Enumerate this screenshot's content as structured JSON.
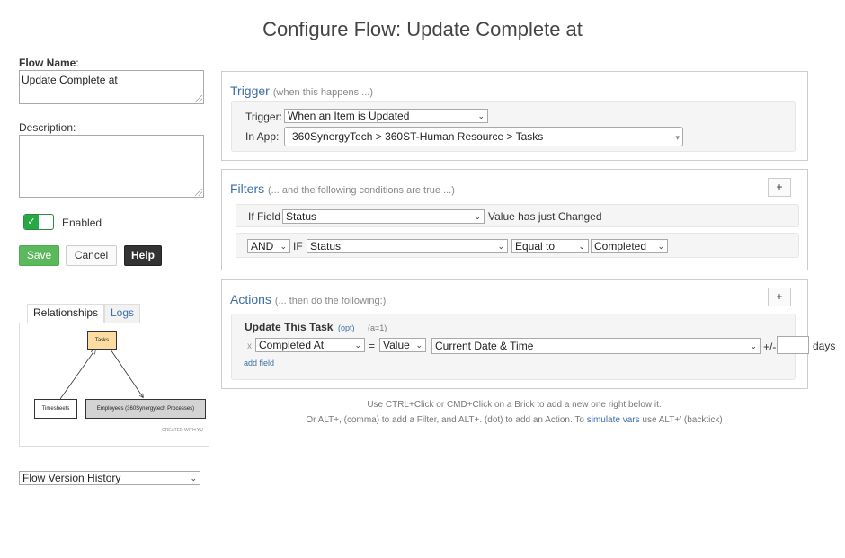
{
  "page": {
    "title": "Configure Flow: Update Complete at"
  },
  "left": {
    "flow_name_label": "Flow Name",
    "flow_name_value": "Update Complete at",
    "description_label": "Description:",
    "description_value": "",
    "enabled_label": "Enabled",
    "enabled": true,
    "buttons": {
      "save": "Save",
      "cancel": "Cancel",
      "help": "Help"
    },
    "tabs": [
      {
        "label": "Relationships",
        "active": true
      },
      {
        "label": "Logs",
        "active": false
      }
    ],
    "diagram": {
      "nodes": {
        "tasks": "Tasks",
        "timesheets": "Timesheets",
        "employees": "Employees (360Synergytech Processes)"
      },
      "watermark": "CREATED WITH YU"
    },
    "version_history": "Flow Version History"
  },
  "trigger": {
    "title": "Trigger",
    "subtitle": "(when this happens ...)",
    "trigger_label": "Trigger:",
    "trigger_value": "When an Item is Updated",
    "app_label": "In App:",
    "app_value": "360SynergyTech > 360ST-Human Resource > Tasks"
  },
  "filters": {
    "title": "Filters",
    "subtitle": "(... and the following conditions are true ...)",
    "add": "+",
    "row1": {
      "prefix": "If Field",
      "field": "Status",
      "suffix": "Value has just Changed"
    },
    "row2": {
      "conj": "AND",
      "if": "IF",
      "field": "Status",
      "op": "Equal to",
      "value": "Completed"
    }
  },
  "actions": {
    "title": "Actions",
    "subtitle": "(... then do the following:)",
    "add": "+",
    "task_title": "Update This Task",
    "opt": "(opt)",
    "count": "(a=1)",
    "remove": "x",
    "field": "Completed At",
    "equals": "=",
    "mode": "Value",
    "value": "Current Date & Time",
    "plusminus": "+/-",
    "days": "days",
    "add_field": "add field"
  },
  "hints": {
    "line1": "Use CTRL+Click or CMD+Click on a Brick to add a new one right below it.",
    "line2_pre": "Or ALT+, (comma) to add a Filter, and ALT+. (dot) to add an Action. To ",
    "line2_link": "simulate vars",
    "line2_post": " use ALT+' (backtick)"
  }
}
